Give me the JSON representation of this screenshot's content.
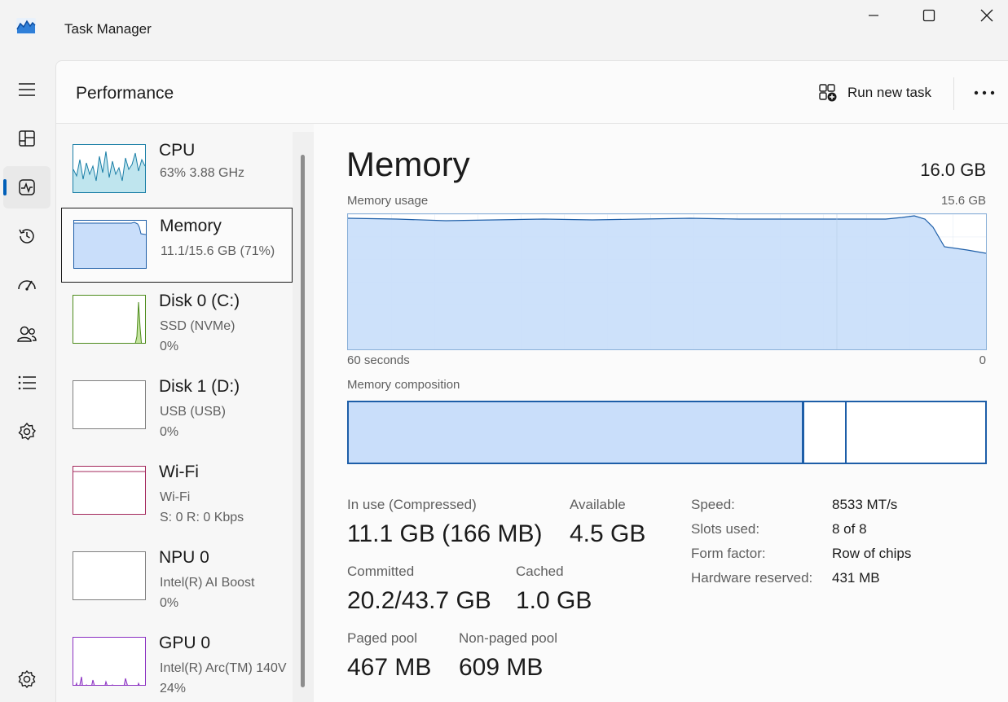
{
  "window": {
    "title": "Task Manager"
  },
  "header": {
    "page_title": "Performance",
    "run_new_task": "Run new task"
  },
  "sidebar": {
    "items": [
      {
        "name": "CPU",
        "line1": "63%  3.88 GHz",
        "line2": ""
      },
      {
        "name": "Memory",
        "line1": "11.1/15.6 GB (71%)",
        "line2": ""
      },
      {
        "name": "Disk 0 (C:)",
        "line1": "SSD (NVMe)",
        "line2": "0%"
      },
      {
        "name": "Disk 1 (D:)",
        "line1": "USB (USB)",
        "line2": "0%"
      },
      {
        "name": "Wi-Fi",
        "line1": "Wi-Fi",
        "line2": "S: 0  R: 0 Kbps"
      },
      {
        "name": "NPU 0",
        "line1": "Intel(R) AI Boost",
        "line2": "0%"
      },
      {
        "name": "GPU 0",
        "line1": "Intel(R) Arc(TM) 140V",
        "line2": "24%"
      }
    ]
  },
  "detail": {
    "title": "Memory",
    "total": "16.0 GB",
    "usage_label": "Memory usage",
    "usage_max": "15.6 GB",
    "time_left": "60 seconds",
    "time_right": "0",
    "composition_label": "Memory composition",
    "composition": {
      "in_use_fraction": 0.716,
      "modified_fraction": 0.066
    },
    "stats": {
      "in_use_label": "In use (Compressed)",
      "in_use_value": "11.1 GB (166 MB)",
      "available_label": "Available",
      "available_value": "4.5 GB",
      "committed_label": "Committed",
      "committed_value": "20.2/43.7 GB",
      "cached_label": "Cached",
      "cached_value": "1.0 GB",
      "paged_label": "Paged pool",
      "paged_value": "467 MB",
      "nonpaged_label": "Non-paged pool",
      "nonpaged_value": "609 MB"
    },
    "specs": [
      {
        "label": "Speed:",
        "value": "8533 MT/s"
      },
      {
        "label": "Slots used:",
        "value": "8 of 8"
      },
      {
        "label": "Form factor:",
        "value": "Row of chips"
      },
      {
        "label": "Hardware reserved:",
        "value": "431 MB"
      }
    ]
  },
  "colors": {
    "accent": "#005fb8",
    "memory_fill": "#c9defa",
    "memory_line": "#1d5ea8",
    "cpu_fill": "#bfe5ee",
    "cpu_line": "#1a7ea6",
    "disk_fill": "#c4e39f",
    "disk_line": "#4d8b1b",
    "wifi_line": "#a3275b",
    "gpu_fill": "#e1c8f2",
    "gpu_line": "#8a2fc1"
  },
  "icons": {
    "nav": [
      "hamburger-icon",
      "processes-icon",
      "performance-icon",
      "app-history-icon",
      "startup-apps-icon",
      "users-icon",
      "details-icon",
      "services-icon",
      "settings-icon"
    ]
  }
}
